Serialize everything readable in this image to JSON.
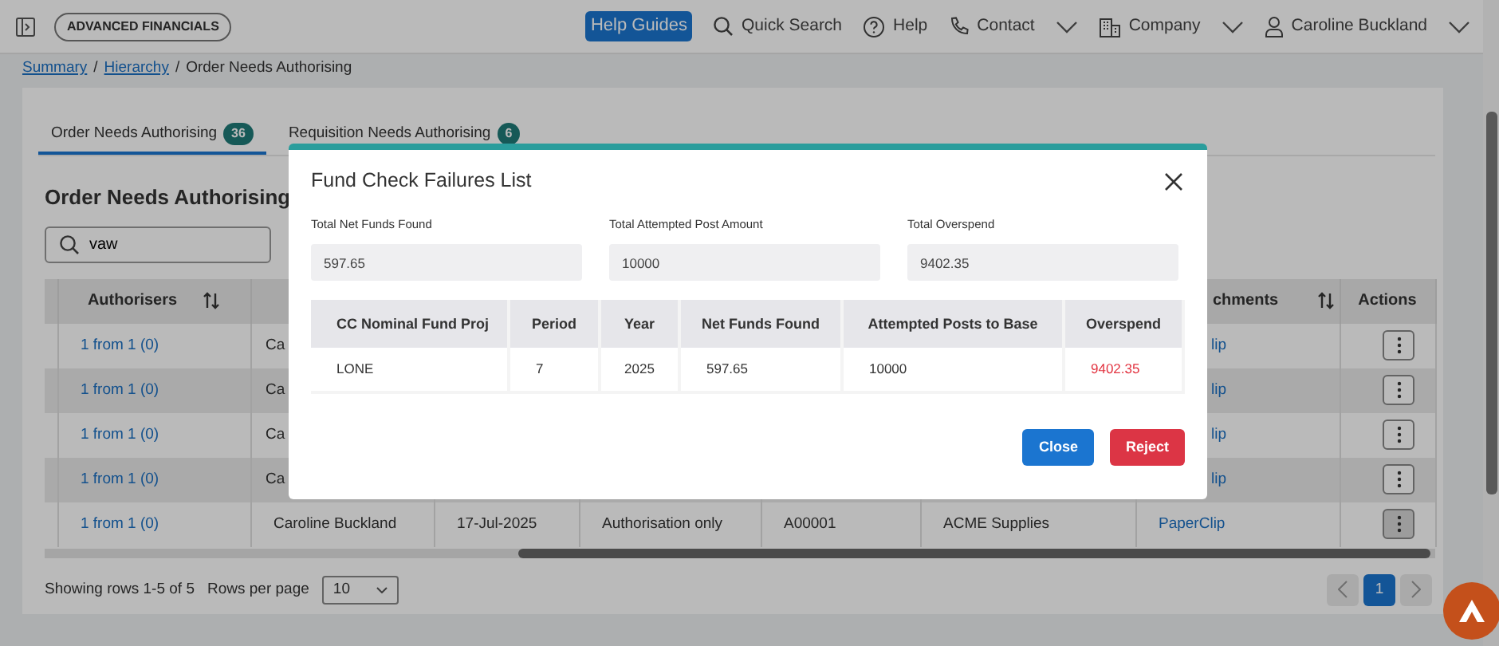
{
  "header": {
    "brand": "ADVANCED FINANCIALS",
    "help_guides": "Help Guides",
    "nav": [
      {
        "label": "Quick Search",
        "dropdown": false
      },
      {
        "label": "Help",
        "dropdown": false
      },
      {
        "label": "Contact",
        "dropdown": true
      },
      {
        "label": "Company",
        "dropdown": true
      },
      {
        "label": "Caroline Buckland",
        "dropdown": true
      }
    ]
  },
  "breadcrumb": [
    {
      "label": "Summary",
      "kind": "link"
    },
    {
      "label": "/",
      "kind": "separator"
    },
    {
      "label": "Hierarchy",
      "kind": "link"
    },
    {
      "label": "/",
      "kind": "separator"
    },
    {
      "label": "Order Needs Authorising",
      "kind": "current"
    }
  ],
  "tabs": [
    {
      "label": "Order Needs Authorising",
      "count": "36",
      "selected": true
    },
    {
      "label": "Requisition Needs Authorising",
      "count": "6",
      "selected": false
    }
  ],
  "panel_title": "Order Needs Authorising",
  "search": {
    "value": "vaw"
  },
  "table": {
    "columns": [
      {
        "label": "Authorisers",
        "sortable": true
      },
      {
        "label": "chments",
        "sortable": true
      },
      {
        "label": "Actions",
        "sortable": false
      }
    ],
    "rows": [
      {
        "authorisers": "1 from 1 (0)",
        "column_2": "Ca",
        "attachments": "lip",
        "active": false
      },
      {
        "authorisers": "1 from 1 (0)",
        "column_2": "Ca",
        "attachments": "lip",
        "active": false
      },
      {
        "authorisers": "1 from 1 (0)",
        "column_2": "Ca",
        "attachments": "lip",
        "active": false
      },
      {
        "authorisers": "1 from 1 (0)",
        "column_2": "Ca",
        "attachments": "lip",
        "active": false
      },
      {
        "authorisers": "1 from 1 (0)",
        "column_2": "Caroline Buckland",
        "column_3": "17-Jul-2025",
        "column_4": "Authorisation only",
        "column_5": "A00001",
        "column_6": "ACME Supplies",
        "attachments": "PaperClip",
        "active": true
      }
    ]
  },
  "footer": {
    "showing": "Showing rows 1-5 of 5",
    "rows_per_page_label": "Rows per page",
    "rows_per_page": "10",
    "pages": [
      {
        "label": "1",
        "selected": true
      }
    ]
  },
  "modal": {
    "title": "Fund Check Failures List",
    "summary": [
      {
        "label": "Total Net Funds Found",
        "value": "597.65"
      },
      {
        "label": "Total Attempted Post Amount",
        "value": "10000"
      },
      {
        "label": "Total Overspend",
        "value": "9402.35"
      }
    ],
    "table": {
      "columns": [
        "CC Nominal Fund Proj",
        "Period",
        "Year",
        "Net Funds Found",
        "Attempted Posts to Base",
        "Overspend"
      ],
      "rows": [
        {
          "cells": [
            "LONE",
            "7",
            "2025",
            "597.65",
            "10000",
            "9402.35"
          ],
          "overspent": true
        }
      ]
    },
    "buttons": [
      {
        "label": "Close",
        "kind": "primary"
      },
      {
        "label": "Reject",
        "kind": "danger"
      }
    ]
  }
}
